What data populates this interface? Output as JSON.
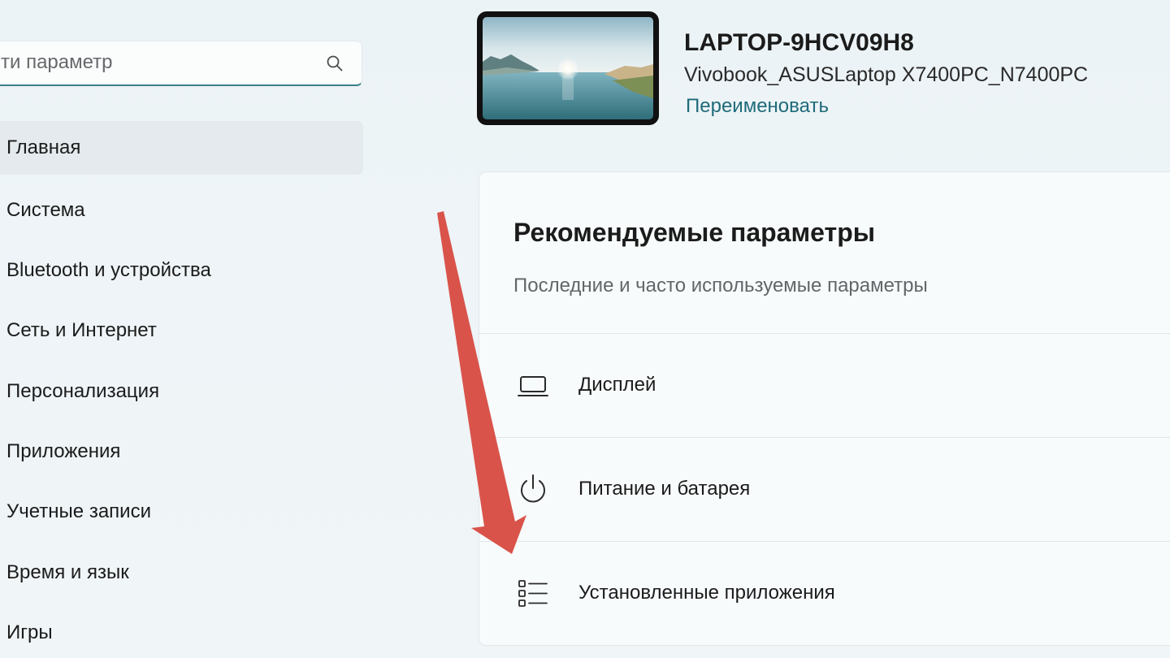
{
  "search": {
    "placeholder": "ти параметр",
    "icon": "search-icon"
  },
  "sidebar": {
    "active_index": 0,
    "items": [
      {
        "label": "Главная"
      },
      {
        "label": "Система"
      },
      {
        "label": "Bluetooth и устройства"
      },
      {
        "label": "Сеть и Интернет"
      },
      {
        "label": "Персонализация"
      },
      {
        "label": "Приложения"
      },
      {
        "label": "Учетные записи"
      },
      {
        "label": "Время и язык"
      },
      {
        "label": "Игры"
      }
    ]
  },
  "device": {
    "name": "LAPTOP-9HCV09H8",
    "model": "Vivobook_ASUSLaptop X7400PC_N7400PC",
    "rename_label": "Переименовать"
  },
  "recommended": {
    "title": "Рекомендуемые параметры",
    "subtitle": "Последние и часто используемые параметры",
    "items": [
      {
        "label": "Дисплей",
        "icon": "display-icon"
      },
      {
        "label": "Питание и батарея",
        "icon": "power-icon"
      },
      {
        "label": "Установленные приложения",
        "icon": "apps-list-icon"
      }
    ]
  },
  "colors": {
    "accent": "#1f6b7a",
    "annotation_arrow": "#d9534a"
  }
}
